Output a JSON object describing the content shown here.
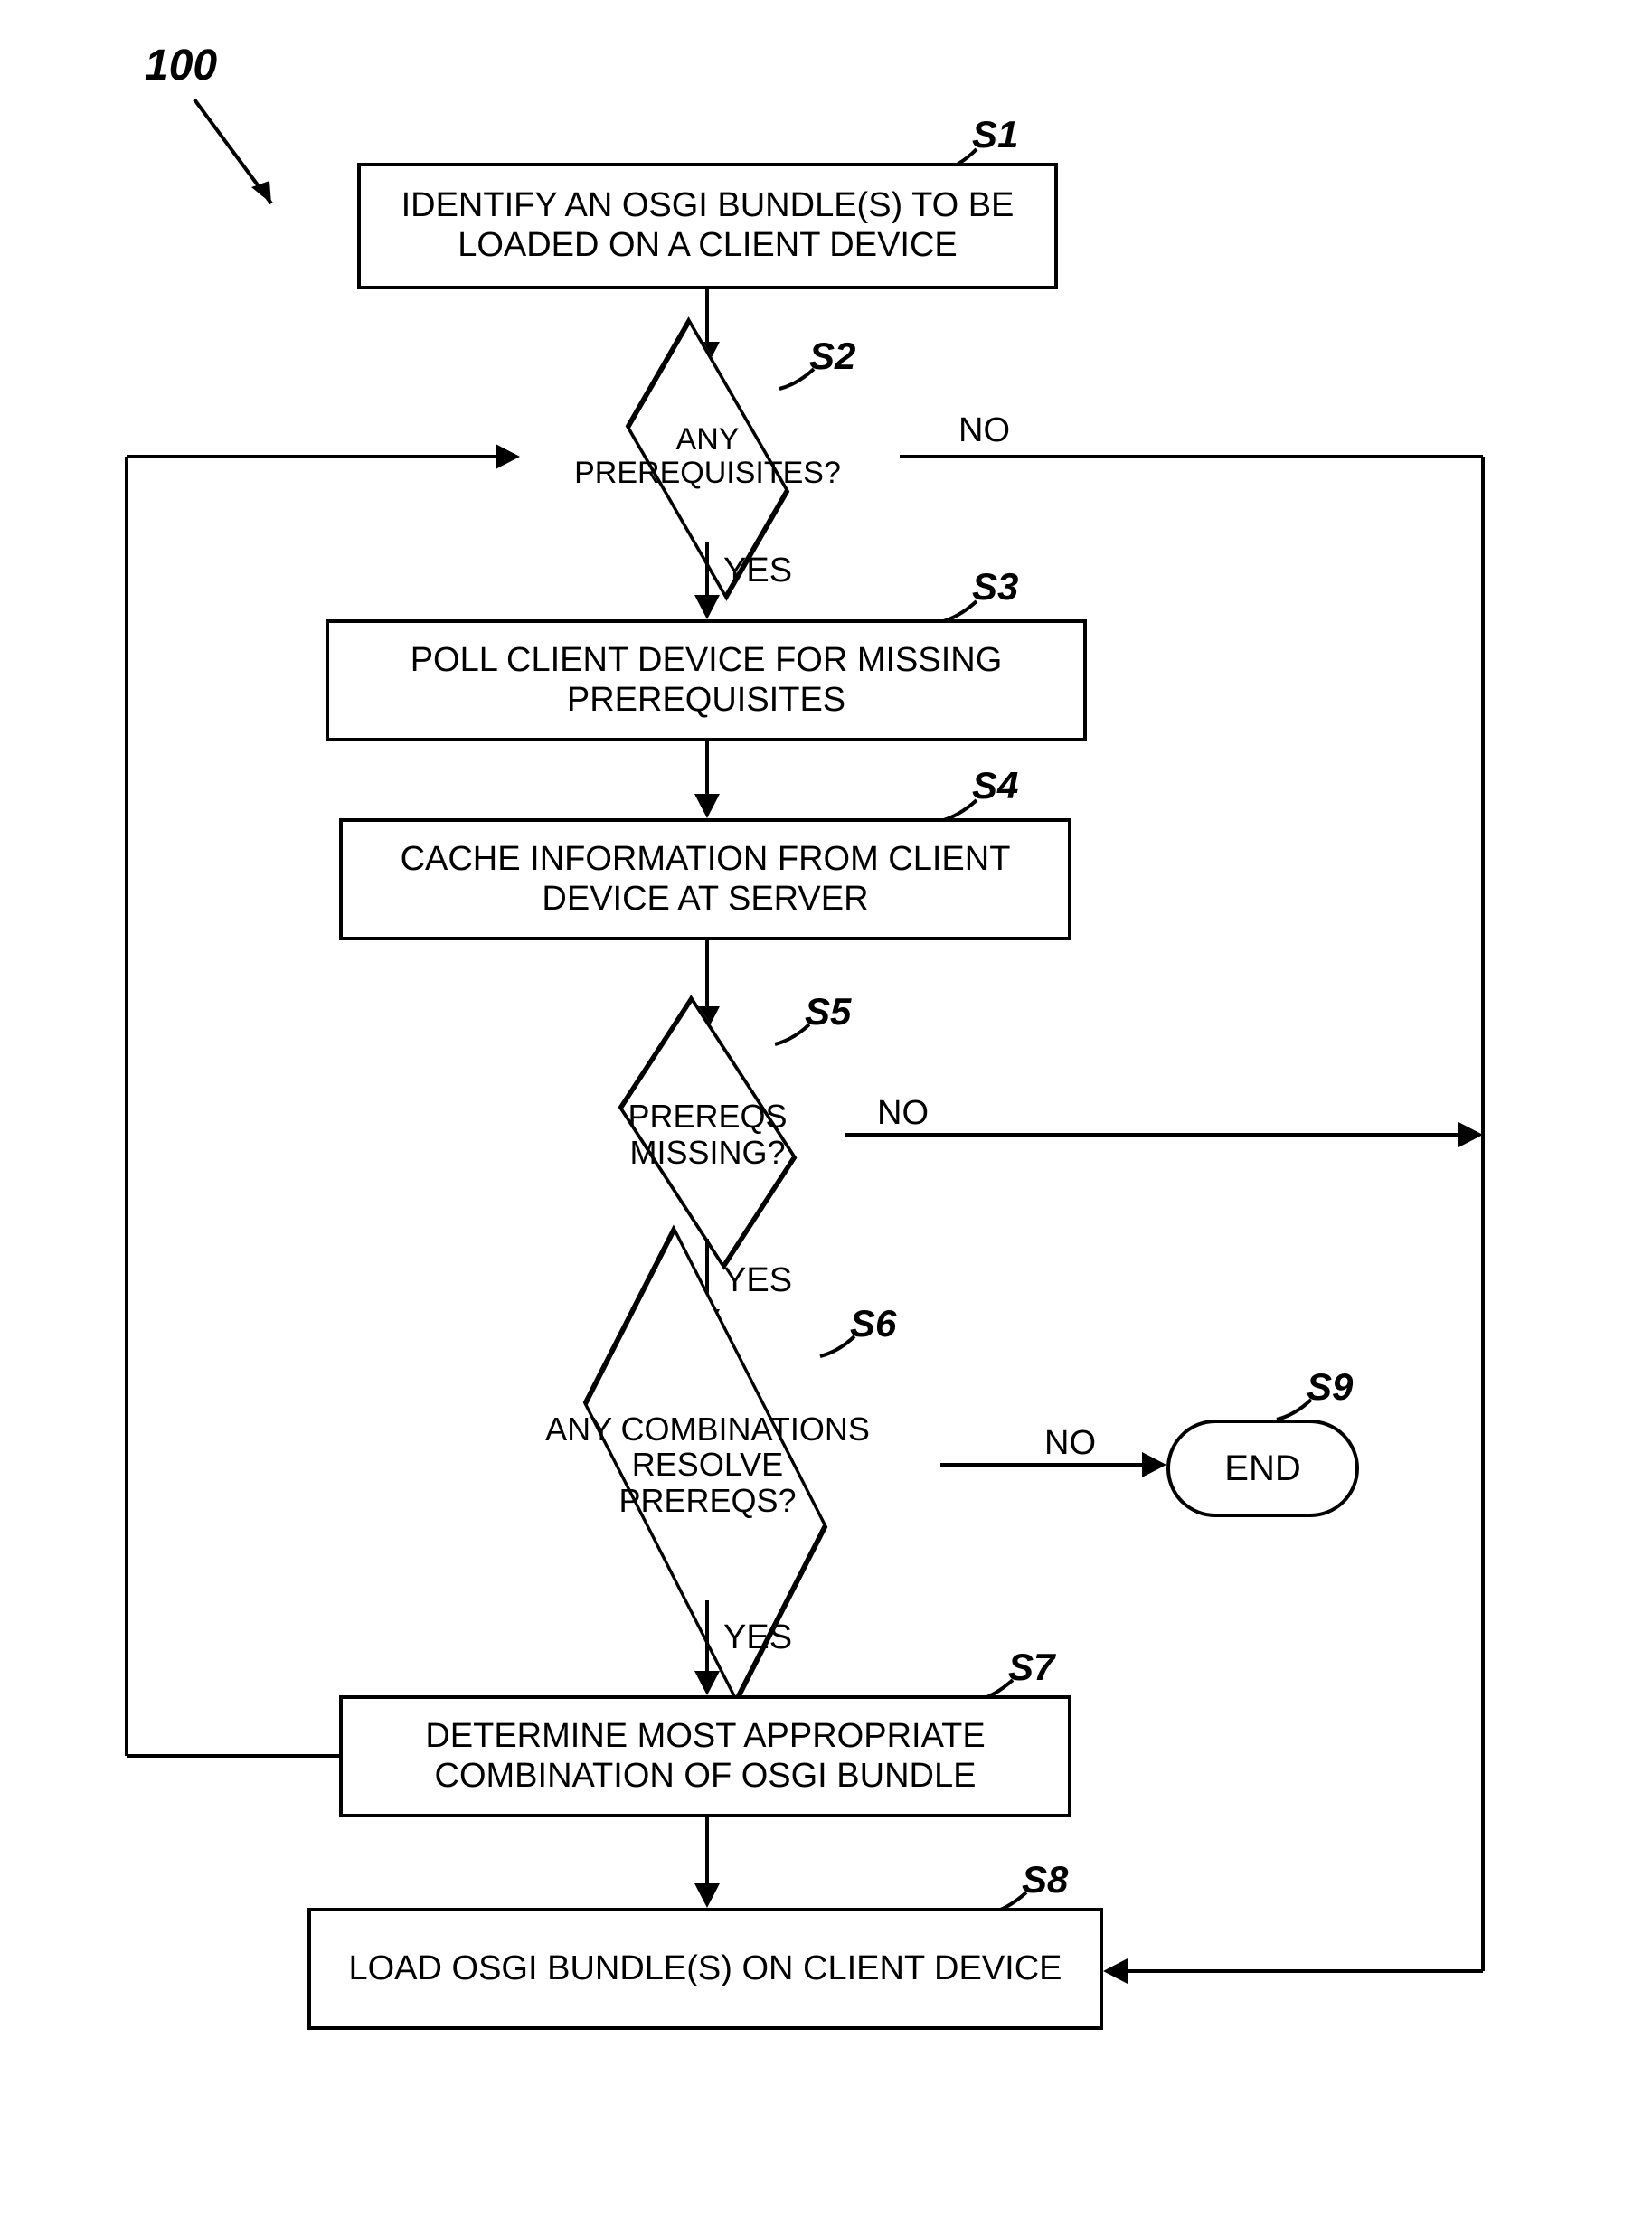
{
  "diagram_label": "100",
  "steps": {
    "s1": {
      "label": "S1",
      "text": "IDENTIFY AN OSGI BUNDLE(S) TO BE LOADED ON A CLIENT DEVICE"
    },
    "s2": {
      "label": "S2",
      "text": "ANY PREREQUISITES?"
    },
    "s3": {
      "label": "S3",
      "text": "POLL CLIENT DEVICE FOR MISSING PREREQUISITES"
    },
    "s4": {
      "label": "S4",
      "text": "CACHE INFORMATION FROM CLIENT DEVICE AT SERVER"
    },
    "s5": {
      "label": "S5",
      "text": "PREREQS MISSING?"
    },
    "s6": {
      "label": "S6",
      "text": "ANY COMBINATIONS RESOLVE PREREQS?"
    },
    "s7": {
      "label": "S7",
      "text": "DETERMINE MOST APPROPRIATE COMBINATION OF OSGI BUNDLE"
    },
    "s8": {
      "label": "S8",
      "text": "LOAD OSGI BUNDLE(S) ON CLIENT DEVICE"
    },
    "s9": {
      "label": "S9",
      "text": "END"
    }
  },
  "edges": {
    "yes": "YES",
    "no": "NO"
  }
}
